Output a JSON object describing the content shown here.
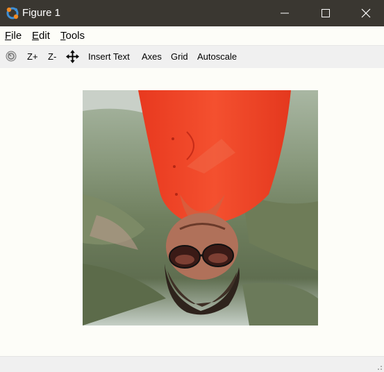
{
  "window": {
    "title": "Figure 1",
    "icon": "octave-icon",
    "controls": [
      "minimize-icon",
      "maximize-icon",
      "close-icon"
    ]
  },
  "menubar": {
    "file": {
      "mnemonic": "F",
      "rest": "ile"
    },
    "edit": {
      "mnemonic": "E",
      "rest": "dit"
    },
    "tools": {
      "mnemonic": "T",
      "rest": "ools"
    }
  },
  "toolbar": {
    "rotate_icon": "rotate-3d-icon",
    "zoom_in": "Z+",
    "zoom_out": "Z-",
    "pan_icon": "pan-icon",
    "insert_text": "Insert Text",
    "axes": "Axes",
    "grid": "Grid",
    "autoscale": "Autoscale"
  },
  "figure": {
    "image_description": "upside-down portrait photo of a man in an orange shirt and sunglasses against a green landscape",
    "colors": {
      "shirt": "#f4472a",
      "background": "#fdfdf8"
    }
  }
}
